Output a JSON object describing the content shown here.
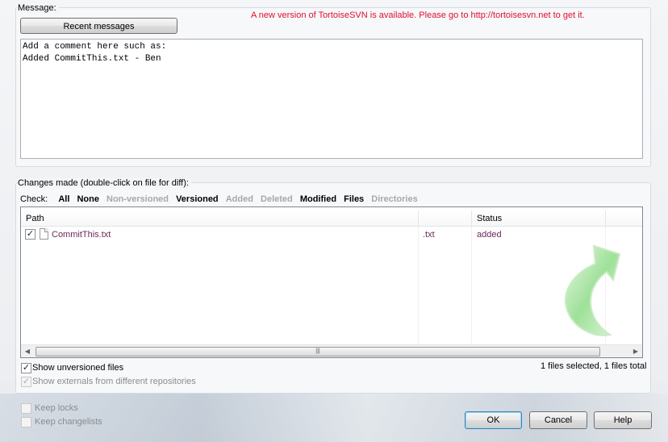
{
  "message": {
    "label": "Message:",
    "recent_button": "Recent messages",
    "update_notice": "A new version of TortoiseSVN is available. Please go to http://tortoisesvn.net to get it.",
    "text": "Add a comment here such as:\nAdded CommitThis.txt - Ben"
  },
  "changes": {
    "label": "Changes made (double-click on file for diff):",
    "check_label": "Check:",
    "filters": [
      {
        "label": "All",
        "enabled": true
      },
      {
        "label": "None",
        "enabled": true
      },
      {
        "label": "Non-versioned",
        "enabled": false
      },
      {
        "label": "Versioned",
        "enabled": true
      },
      {
        "label": "Added",
        "enabled": false
      },
      {
        "label": "Deleted",
        "enabled": false
      },
      {
        "label": "Modified",
        "enabled": true
      },
      {
        "label": "Files",
        "enabled": true
      },
      {
        "label": "Directories",
        "enabled": false
      }
    ],
    "columns": {
      "path": "Path",
      "status": "Status"
    },
    "rows": [
      {
        "checked": true,
        "path": "CommitThis.txt",
        "ext": ".txt",
        "status": "added"
      }
    ],
    "show_unversioned": "Show unversioned files",
    "show_externals": "Show externals from different repositories",
    "selection_summary": "1 files selected, 1 files total"
  },
  "options": {
    "keep_locks": "Keep locks",
    "keep_changelists": "Keep changelists"
  },
  "buttons": {
    "ok": "OK",
    "cancel": "Cancel",
    "help": "Help"
  },
  "colors": {
    "notice": "#e0102e",
    "file_text": "#6a2a5a",
    "logo_green": "#7dd37a"
  }
}
